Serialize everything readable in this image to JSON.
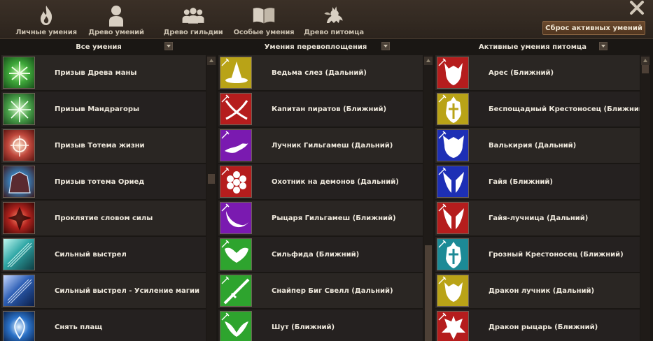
{
  "tabs": [
    {
      "label": "Личные умения",
      "icon": "flame-icon"
    },
    {
      "label": "Древо умений",
      "icon": "person-icon"
    },
    {
      "label": "Древо гильдии",
      "icon": "group-icon"
    },
    {
      "label": "Особые умения",
      "icon": "book-icon"
    },
    {
      "label": "Древо питомца",
      "icon": "pet-icon"
    }
  ],
  "reset_button": "Сброс активных умений",
  "columns": [
    {
      "header": "Все умения"
    },
    {
      "header": "Умения перевоплощения"
    },
    {
      "header": "Активные умения питомца"
    }
  ],
  "all_skills": [
    {
      "label": "Призыв Древа маны",
      "color": "#3fa83a"
    },
    {
      "label": "Призыв Мандрагоры",
      "color": "#4aa24a"
    },
    {
      "label": "Призыв Тотема жизни",
      "color": "#c0483c"
    },
    {
      "label": "Призыв тотема Ориед",
      "color": "#3a7fb8"
    },
    {
      "label": "Проклятие словом силы",
      "color": "#b2231e"
    },
    {
      "label": "Сильный выстрел",
      "color": "#2fa7a6"
    },
    {
      "label": "Сильный выстрел - Усиление магии",
      "color": "#2d5fb5"
    },
    {
      "label": "Снять плащ",
      "color": "#2b72c8"
    }
  ],
  "transform_skills": [
    {
      "label": "Ведьма слез (Дальний)",
      "color": "#b9a317"
    },
    {
      "label": "Капитан пиратов (Ближний)",
      "color": "#b51d1d"
    },
    {
      "label": "Лучник Гильгамеш (Дальний)",
      "color": "#7a1ab0"
    },
    {
      "label": "Охотник на демонов (Дальний)",
      "color": "#b51d1d"
    },
    {
      "label": "Рыцаря Гильгамеш (Ближний)",
      "color": "#7a1ab0"
    },
    {
      "label": "Сильфида (Ближний)",
      "color": "#2ea42e"
    },
    {
      "label": "Снайпер Биг Свелл (Дальний)",
      "color": "#2ea42e"
    },
    {
      "label": "Шут (Ближний)",
      "color": "#2ea42e"
    }
  ],
  "pet_skills": [
    {
      "label": "Арес (Ближний)",
      "color": "#b51d1d"
    },
    {
      "label": "Беспощадный Крестоносец (Ближний)",
      "color": "#b9a317"
    },
    {
      "label": "Валькирия (Дальний)",
      "color": "#1d2fb5"
    },
    {
      "label": "Гайя (Ближний)",
      "color": "#1d2fb5"
    },
    {
      "label": "Гайя-лучница (Дальний)",
      "color": "#b51d1d"
    },
    {
      "label": "Грозный Крестоносец (Ближний)",
      "color": "#1c8a96"
    },
    {
      "label": "Дракон лучник (Дальний)",
      "color": "#b9a317"
    },
    {
      "label": "Дракон рыцарь (Ближний)",
      "color": "#b51d1d"
    }
  ]
}
